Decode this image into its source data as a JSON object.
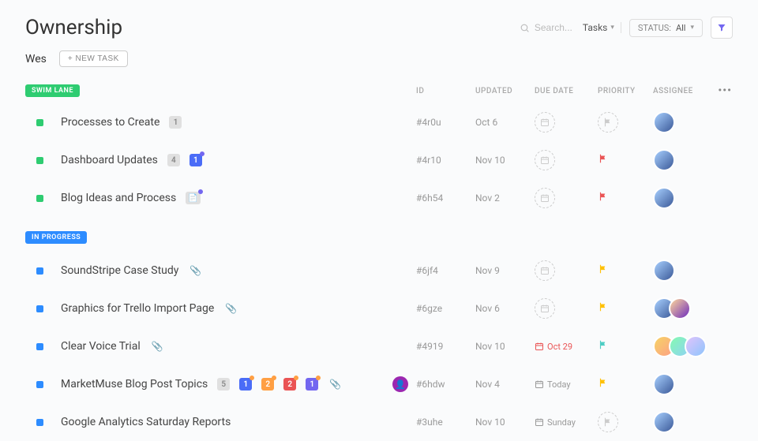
{
  "header": {
    "title": "Ownership",
    "search_placeholder": "Search...",
    "tasks_label": "Tasks",
    "status_label": "STATUS:",
    "status_value": "All"
  },
  "subheader": {
    "owner": "Wes",
    "new_task_label": "+ NEW TASK"
  },
  "columns": {
    "id": "ID",
    "updated": "UPDATED",
    "due": "DUE DATE",
    "priority": "PRIORITY",
    "assignee": "ASSIGNEE"
  },
  "lanes": [
    {
      "label": "SWIM LANE",
      "color": "#2ecc71",
      "status_color": "#2ecc71",
      "tasks": [
        {
          "title": "Processes to Create",
          "badges": [
            {
              "n": "1",
              "c": "gray"
            }
          ],
          "attach": false,
          "id": "#4r0u",
          "updated": "Oct 6",
          "due": null,
          "priority": null,
          "assignees": [
            "a"
          ]
        },
        {
          "title": "Dashboard Updates",
          "badges": [
            {
              "n": "4",
              "c": "gray"
            },
            {
              "n": "1",
              "c": "blue",
              "dot": "p"
            }
          ],
          "attach": false,
          "id": "#4r10",
          "updated": "Nov 10",
          "due": null,
          "priority": "red",
          "assignees": [
            "a"
          ]
        },
        {
          "title": "Blog Ideas and Process",
          "badges": [
            {
              "n": "",
              "c": "gray",
              "dot": "p",
              "icon": "note"
            }
          ],
          "attach": false,
          "id": "#6h54",
          "updated": "Nov 2",
          "due": null,
          "priority": "red",
          "assignees": [
            "a"
          ]
        }
      ]
    },
    {
      "label": "IN PROGRESS",
      "color": "#2d8cff",
      "status_color": "#2d8cff",
      "tasks": [
        {
          "title": "SoundStripe Case Study",
          "badges": [],
          "attach": true,
          "id": "#6jf4",
          "updated": "Nov 9",
          "due": null,
          "priority": "yellow",
          "assignees": [
            "a"
          ]
        },
        {
          "title": "Graphics for Trello Import Page",
          "badges": [],
          "attach": true,
          "id": "#6gze",
          "updated": "Nov 6",
          "due": null,
          "priority": "yellow",
          "assignees": [
            "a",
            "b"
          ]
        },
        {
          "title": "Clear Voice Trial",
          "badges": [],
          "attach": true,
          "id": "#4919",
          "updated": "Nov 10",
          "due": {
            "text": "Oct 29",
            "style": "red"
          },
          "priority": "cyan",
          "assignees": [
            "c",
            "d",
            "e"
          ]
        },
        {
          "title": "MarketMuse Blog Post Topics",
          "badges": [
            {
              "n": "5",
              "c": "gray"
            },
            {
              "n": "1",
              "c": "blue",
              "dot": "o"
            },
            {
              "n": "2",
              "c": "orange",
              "dot": "o"
            },
            {
              "n": "2",
              "c": "red",
              "dot": "o"
            },
            {
              "n": "1",
              "c": "purple",
              "dot": "o"
            }
          ],
          "attach": true,
          "user_bubble": true,
          "id": "#6hdw",
          "updated": "Nov 4",
          "due": {
            "text": "Today",
            "style": "gray"
          },
          "priority": "yellow",
          "assignees": [
            "a"
          ]
        },
        {
          "title": "Google Analytics Saturday Reports",
          "badges": [],
          "attach": false,
          "id": "#3uhe",
          "updated": "Nov 10",
          "due": {
            "text": "Sunday",
            "style": "gray"
          },
          "priority": null,
          "assignees": [
            "a"
          ]
        }
      ]
    }
  ],
  "priority_colors": {
    "red": "#ea5455",
    "yellow": "#ffc107",
    "cyan": "#4ecdc4"
  }
}
